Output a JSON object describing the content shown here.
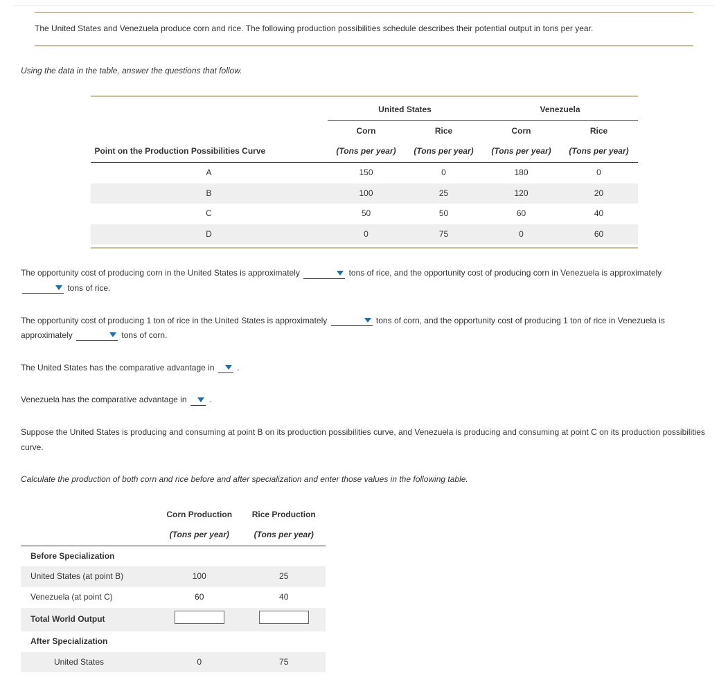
{
  "intro": "The United States and Venezuela produce corn and rice. The following production possibilities schedule describes their potential output in tons per year.",
  "prompt1": "Using the data in the table, answer the questions that follow.",
  "ppc": {
    "country1": "United States",
    "country2": "Venezuela",
    "good1": "Corn",
    "good2": "Rice",
    "point_header": "Point on the Production Possibilities Curve",
    "unit": "(Tons per year)",
    "rows": [
      {
        "pt": "A",
        "us_corn": "150",
        "us_rice": "0",
        "vz_corn": "180",
        "vz_rice": "0"
      },
      {
        "pt": "B",
        "us_corn": "100",
        "us_rice": "25",
        "vz_corn": "120",
        "vz_rice": "20"
      },
      {
        "pt": "C",
        "us_corn": "50",
        "us_rice": "50",
        "vz_corn": "60",
        "vz_rice": "40"
      },
      {
        "pt": "D",
        "us_corn": "0",
        "us_rice": "75",
        "vz_corn": "0",
        "vz_rice": "60"
      }
    ]
  },
  "q1a": "The opportunity cost of producing corn in the United States is approximately ",
  "q1b": " tons of rice, and the opportunity cost of producing corn in Venezuela is approximately ",
  "q1c": " tons of rice.",
  "q2a": "The opportunity cost of producing 1 ton of rice in the United States is approximately ",
  "q2b": " tons of corn, and the opportunity cost of producing 1 ton of rice in Venezuela is approximately ",
  "q2c": " tons of corn.",
  "q3a": "The United States has the comparative advantage in ",
  "q3b": " .",
  "q4a": "Venezuela has the comparative advantage in ",
  "q4b": " .",
  "scenario": "Suppose the United States is producing and consuming at point B on its production possibilities curve, and Venezuela is producing and consuming at point C on its production possibilities curve.",
  "prompt2": "Calculate the production of both corn and rice before and after specialization and enter those values in the following table.",
  "spec": {
    "col1": "Corn Production",
    "col2": "Rice Production",
    "unit": "(Tons per year)",
    "before": "Before Specialization",
    "usB": "United States (at point B)",
    "vzC": "Venezuela (at point C)",
    "total": "Total World Output",
    "after": "After Specialization",
    "us": "United States",
    "vals": {
      "usB_corn": "100",
      "usB_rice": "25",
      "vzC_corn": "60",
      "vzC_rice": "40",
      "us_after_corn": "0",
      "us_after_rice": "75"
    }
  }
}
